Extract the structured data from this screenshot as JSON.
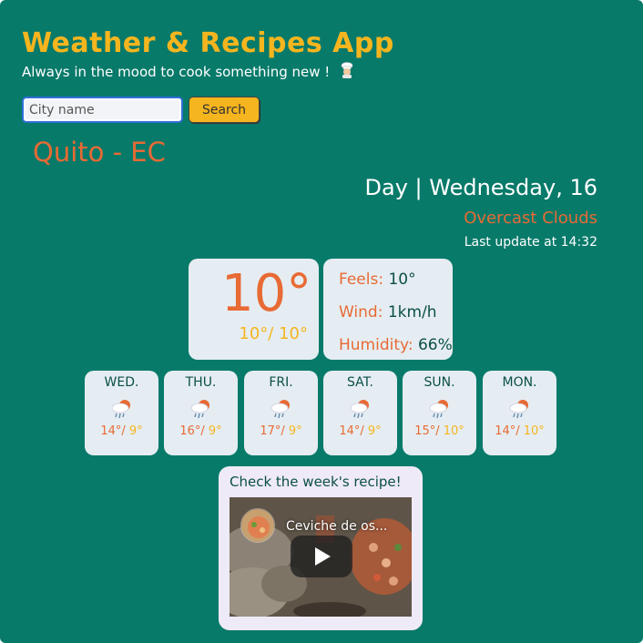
{
  "header": {
    "title": "Weather & Recipes App",
    "subtitle": "Always in the mood to cook something new !",
    "chef_icon": "chef-icon"
  },
  "search": {
    "placeholder": "City name",
    "value": "",
    "button_label": "Search"
  },
  "current": {
    "city": "Quito - EC",
    "date": "Day | Wednesday, 16",
    "description": "Overcast Clouds",
    "last_update": "Last update at 14:32",
    "temperature": "10°",
    "range": "10°/ 10°",
    "feels_label": "Feels:",
    "feels_value": "10°",
    "wind_label": "Wind:",
    "wind_value": "1km/h",
    "humidity_label": "Humidity:",
    "humidity_value": "66%"
  },
  "forecast": [
    {
      "day": "WED.",
      "max": "14°/",
      "min": " 9°",
      "icon": "rain-cloud-icon"
    },
    {
      "day": "THU.",
      "max": "16°/",
      "min": " 9°",
      "icon": "rain-cloud-icon"
    },
    {
      "day": "FRI.",
      "max": "17°/",
      "min": " 9°",
      "icon": "rain-cloud-icon"
    },
    {
      "day": "SAT.",
      "max": "14°/",
      "min": " 9°",
      "icon": "rain-cloud-icon"
    },
    {
      "day": "SUN.",
      "max": "15°/",
      "min": " 10°",
      "icon": "rain-cloud-icon"
    },
    {
      "day": "MON.",
      "max": "14°/",
      "min": " 10°",
      "icon": "rain-cloud-icon"
    }
  ],
  "recipe": {
    "heading": "Check the week's recipe!",
    "video_title": "Ceviche de os..."
  },
  "colors": {
    "background": "#087a6a",
    "accent_yellow": "#f5b51e",
    "accent_orange": "#e86a34",
    "card": "#e5edf2"
  }
}
